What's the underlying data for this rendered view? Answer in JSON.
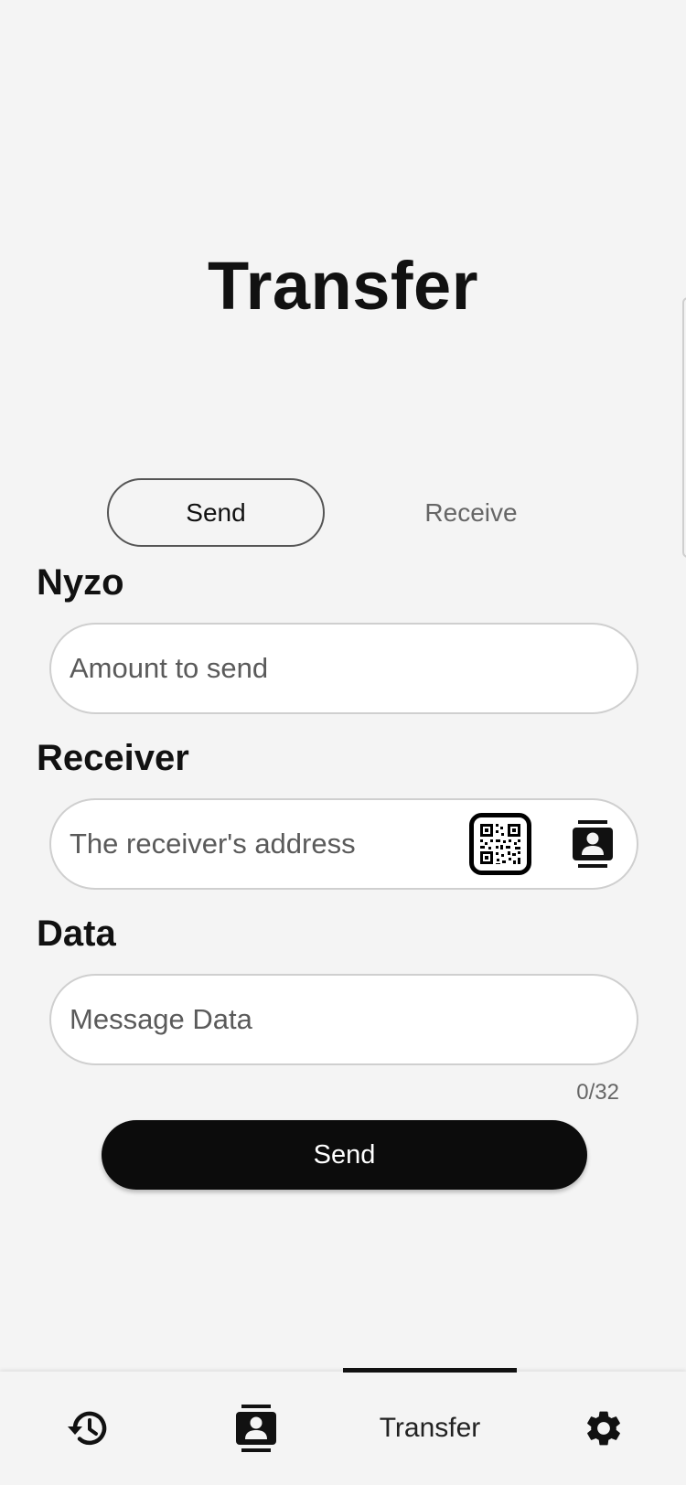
{
  "header": {
    "title": "Transfer"
  },
  "segmented": {
    "send_label": "Send",
    "receive_label": "Receive",
    "selected": "Send"
  },
  "form": {
    "amount": {
      "label": "Nyzo",
      "placeholder": "Amount to send",
      "value": ""
    },
    "receiver": {
      "label": "Receiver",
      "placeholder": "The receiver's address",
      "value": "",
      "qr_icon": "qr-code-icon",
      "contacts_icon": "contacts-icon"
    },
    "data": {
      "label": "Data",
      "placeholder": "Message Data",
      "value": "",
      "counter": "0/32"
    },
    "submit_label": "Send"
  },
  "bottom_nav": {
    "items": [
      {
        "icon": "history-icon"
      },
      {
        "icon": "contacts-icon"
      },
      {
        "label": "Transfer",
        "active": true
      },
      {
        "icon": "gear-icon"
      }
    ]
  },
  "colors": {
    "background": "#f4f4f4",
    "primary": "#0c0c0c",
    "field_border": "#cfcfcf",
    "muted_text": "#666666"
  }
}
